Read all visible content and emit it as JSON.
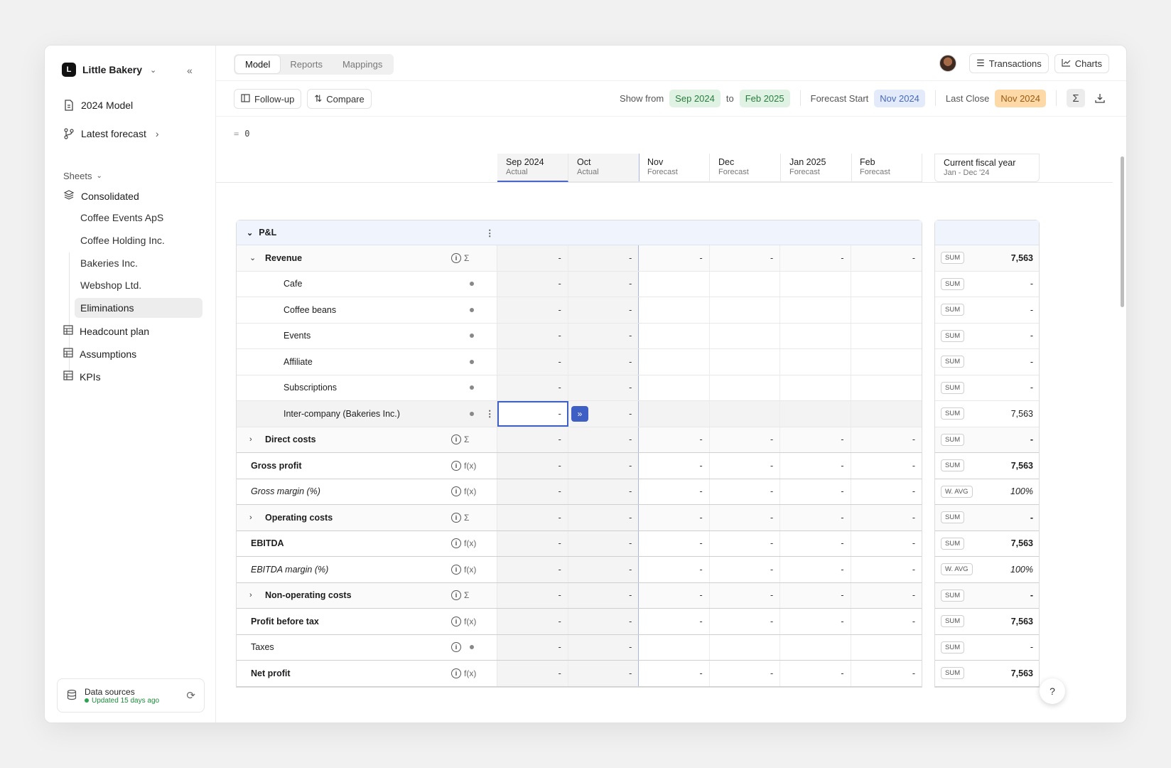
{
  "company": {
    "initial": "L",
    "name": "Little Bakery"
  },
  "nav": {
    "model": "2024 Model",
    "forecast": "Latest forecast"
  },
  "sheets": {
    "label": "Sheets",
    "consolidated": "Consolidated",
    "entities": [
      "Coffee Events ApS",
      "Coffee Holding Inc.",
      "Bakeries Inc.",
      "Webshop Ltd.",
      "Eliminations"
    ],
    "other": [
      "Headcount plan",
      "Assumptions",
      "KPIs"
    ]
  },
  "datasources": {
    "title": "Data sources",
    "status": "Updated 15 days ago"
  },
  "tabs": [
    "Model",
    "Reports",
    "Mappings"
  ],
  "topbar": {
    "transactions": "Transactions",
    "charts": "Charts"
  },
  "toolbar": {
    "followup": "Follow-up",
    "compare": "Compare",
    "show_from_label": "Show from",
    "show_from": "Sep 2024",
    "to_label": "to",
    "to": "Feb 2025",
    "forecast_start_label": "Forecast Start",
    "forecast_start": "Nov 2024",
    "last_close_label": "Last Close",
    "last_close": "Nov 2024"
  },
  "formula": {
    "eq": "=",
    "value": "0"
  },
  "columns": [
    {
      "month": "Sep 2024",
      "kind": "Actual"
    },
    {
      "month": "Oct",
      "kind": "Actual"
    },
    {
      "month": "Nov",
      "kind": "Forecast"
    },
    {
      "month": "Dec",
      "kind": "Forecast"
    },
    {
      "month": "Jan 2025",
      "kind": "Forecast"
    },
    {
      "month": "Feb",
      "kind": "Forecast"
    }
  ],
  "fiscal": {
    "title": "Current fiscal year",
    "range": "Jan - Dec '24"
  },
  "section": "P&L",
  "rows": [
    {
      "label": "Revenue",
      "type": "group-open",
      "kind": "Σ",
      "vals": [
        "-",
        "-",
        "-",
        "-",
        "-",
        "-"
      ],
      "agg": "SUM",
      "fy": "7,563"
    },
    {
      "label": "Cafe",
      "type": "child",
      "vals": [
        "-",
        "-",
        "",
        "",
        "",
        ""
      ],
      "agg": "SUM",
      "fy": "-"
    },
    {
      "label": "Coffee beans",
      "type": "child",
      "vals": [
        "-",
        "-",
        "",
        "",
        "",
        ""
      ],
      "agg": "SUM",
      "fy": "-"
    },
    {
      "label": "Events",
      "type": "child",
      "vals": [
        "-",
        "-",
        "",
        "",
        "",
        ""
      ],
      "agg": "SUM",
      "fy": "-"
    },
    {
      "label": "Affiliate",
      "type": "child",
      "vals": [
        "-",
        "-",
        "",
        "",
        "",
        ""
      ],
      "agg": "SUM",
      "fy": "-"
    },
    {
      "label": "Subscriptions",
      "type": "child",
      "vals": [
        "-",
        "-",
        "",
        "",
        "",
        ""
      ],
      "agg": "SUM",
      "fy": "-"
    },
    {
      "label": "Inter-company (Bakeries Inc.)",
      "type": "child-selected",
      "vals": [
        "-",
        "-",
        "",
        "",
        "",
        ""
      ],
      "agg": "SUM",
      "fy": "7,563"
    },
    {
      "label": "Direct costs",
      "type": "group",
      "kind": "Σ",
      "vals": [
        "-",
        "-",
        "-",
        "-",
        "-",
        "-"
      ],
      "agg": "SUM",
      "fy": "-"
    },
    {
      "label": "Gross profit",
      "type": "total",
      "kind": "f(x)",
      "vals": [
        "-",
        "-",
        "-",
        "-",
        "-",
        "-"
      ],
      "agg": "SUM",
      "fy": "7,563"
    },
    {
      "label": "Gross margin (%)",
      "type": "ratio",
      "kind": "f(x)",
      "vals": [
        "-",
        "-",
        "-",
        "-",
        "-",
        "-"
      ],
      "agg": "W. AVG",
      "fy": "100%"
    },
    {
      "label": "Operating costs",
      "type": "group",
      "kind": "Σ",
      "vals": [
        "-",
        "-",
        "-",
        "-",
        "-",
        "-"
      ],
      "agg": "SUM",
      "fy": "-"
    },
    {
      "label": "EBITDA",
      "type": "total",
      "kind": "f(x)",
      "vals": [
        "-",
        "-",
        "-",
        "-",
        "-",
        "-"
      ],
      "agg": "SUM",
      "fy": "7,563"
    },
    {
      "label": "EBITDA margin (%)",
      "type": "ratio",
      "kind": "f(x)",
      "vals": [
        "-",
        "-",
        "-",
        "-",
        "-",
        "-"
      ],
      "agg": "W. AVG",
      "fy": "100%"
    },
    {
      "label": "Non-operating costs",
      "type": "group",
      "kind": "Σ",
      "vals": [
        "-",
        "-",
        "-",
        "-",
        "-",
        "-"
      ],
      "agg": "SUM",
      "fy": "-"
    },
    {
      "label": "Profit before tax",
      "type": "total",
      "kind": "f(x)",
      "vals": [
        "-",
        "-",
        "-",
        "-",
        "-",
        "-"
      ],
      "agg": "SUM",
      "fy": "7,563"
    },
    {
      "label": "Taxes",
      "type": "input",
      "kind": "•",
      "vals": [
        "-",
        "-",
        "",
        "",
        "",
        ""
      ],
      "agg": "SUM",
      "fy": "-"
    },
    {
      "label": "Net profit",
      "type": "total",
      "kind": "f(x)",
      "vals": [
        "-",
        "-",
        "-",
        "-",
        "-",
        "-"
      ],
      "agg": "SUM",
      "fy": "7,563"
    }
  ],
  "help": "?"
}
